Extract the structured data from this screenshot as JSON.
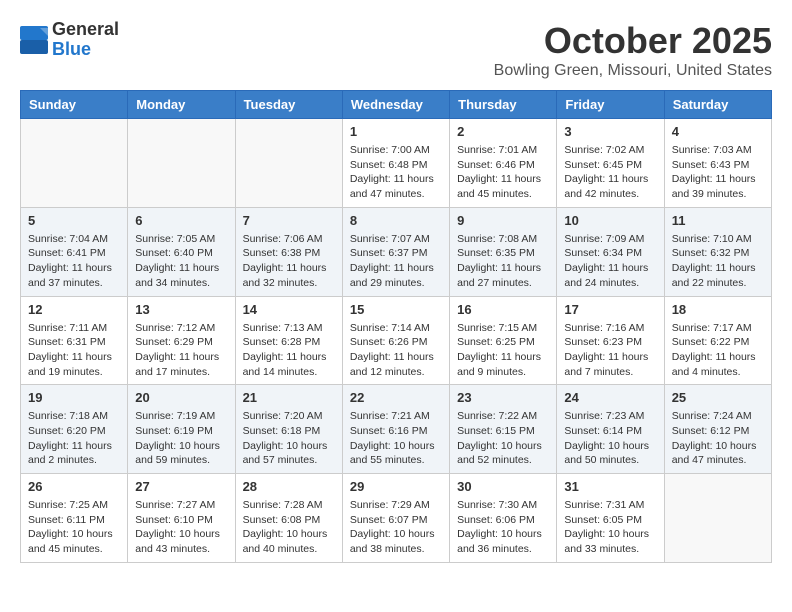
{
  "header": {
    "logo_general": "General",
    "logo_blue": "Blue",
    "month_title": "October 2025",
    "location": "Bowling Green, Missouri, United States"
  },
  "weekdays": [
    "Sunday",
    "Monday",
    "Tuesday",
    "Wednesday",
    "Thursday",
    "Friday",
    "Saturday"
  ],
  "weeks": [
    [
      {
        "day": "",
        "info": ""
      },
      {
        "day": "",
        "info": ""
      },
      {
        "day": "",
        "info": ""
      },
      {
        "day": "1",
        "info": "Sunrise: 7:00 AM\nSunset: 6:48 PM\nDaylight: 11 hours\nand 47 minutes."
      },
      {
        "day": "2",
        "info": "Sunrise: 7:01 AM\nSunset: 6:46 PM\nDaylight: 11 hours\nand 45 minutes."
      },
      {
        "day": "3",
        "info": "Sunrise: 7:02 AM\nSunset: 6:45 PM\nDaylight: 11 hours\nand 42 minutes."
      },
      {
        "day": "4",
        "info": "Sunrise: 7:03 AM\nSunset: 6:43 PM\nDaylight: 11 hours\nand 39 minutes."
      }
    ],
    [
      {
        "day": "5",
        "info": "Sunrise: 7:04 AM\nSunset: 6:41 PM\nDaylight: 11 hours\nand 37 minutes."
      },
      {
        "day": "6",
        "info": "Sunrise: 7:05 AM\nSunset: 6:40 PM\nDaylight: 11 hours\nand 34 minutes."
      },
      {
        "day": "7",
        "info": "Sunrise: 7:06 AM\nSunset: 6:38 PM\nDaylight: 11 hours\nand 32 minutes."
      },
      {
        "day": "8",
        "info": "Sunrise: 7:07 AM\nSunset: 6:37 PM\nDaylight: 11 hours\nand 29 minutes."
      },
      {
        "day": "9",
        "info": "Sunrise: 7:08 AM\nSunset: 6:35 PM\nDaylight: 11 hours\nand 27 minutes."
      },
      {
        "day": "10",
        "info": "Sunrise: 7:09 AM\nSunset: 6:34 PM\nDaylight: 11 hours\nand 24 minutes."
      },
      {
        "day": "11",
        "info": "Sunrise: 7:10 AM\nSunset: 6:32 PM\nDaylight: 11 hours\nand 22 minutes."
      }
    ],
    [
      {
        "day": "12",
        "info": "Sunrise: 7:11 AM\nSunset: 6:31 PM\nDaylight: 11 hours\nand 19 minutes."
      },
      {
        "day": "13",
        "info": "Sunrise: 7:12 AM\nSunset: 6:29 PM\nDaylight: 11 hours\nand 17 minutes."
      },
      {
        "day": "14",
        "info": "Sunrise: 7:13 AM\nSunset: 6:28 PM\nDaylight: 11 hours\nand 14 minutes."
      },
      {
        "day": "15",
        "info": "Sunrise: 7:14 AM\nSunset: 6:26 PM\nDaylight: 11 hours\nand 12 minutes."
      },
      {
        "day": "16",
        "info": "Sunrise: 7:15 AM\nSunset: 6:25 PM\nDaylight: 11 hours\nand 9 minutes."
      },
      {
        "day": "17",
        "info": "Sunrise: 7:16 AM\nSunset: 6:23 PM\nDaylight: 11 hours\nand 7 minutes."
      },
      {
        "day": "18",
        "info": "Sunrise: 7:17 AM\nSunset: 6:22 PM\nDaylight: 11 hours\nand 4 minutes."
      }
    ],
    [
      {
        "day": "19",
        "info": "Sunrise: 7:18 AM\nSunset: 6:20 PM\nDaylight: 11 hours\nand 2 minutes."
      },
      {
        "day": "20",
        "info": "Sunrise: 7:19 AM\nSunset: 6:19 PM\nDaylight: 10 hours\nand 59 minutes."
      },
      {
        "day": "21",
        "info": "Sunrise: 7:20 AM\nSunset: 6:18 PM\nDaylight: 10 hours\nand 57 minutes."
      },
      {
        "day": "22",
        "info": "Sunrise: 7:21 AM\nSunset: 6:16 PM\nDaylight: 10 hours\nand 55 minutes."
      },
      {
        "day": "23",
        "info": "Sunrise: 7:22 AM\nSunset: 6:15 PM\nDaylight: 10 hours\nand 52 minutes."
      },
      {
        "day": "24",
        "info": "Sunrise: 7:23 AM\nSunset: 6:14 PM\nDaylight: 10 hours\nand 50 minutes."
      },
      {
        "day": "25",
        "info": "Sunrise: 7:24 AM\nSunset: 6:12 PM\nDaylight: 10 hours\nand 47 minutes."
      }
    ],
    [
      {
        "day": "26",
        "info": "Sunrise: 7:25 AM\nSunset: 6:11 PM\nDaylight: 10 hours\nand 45 minutes."
      },
      {
        "day": "27",
        "info": "Sunrise: 7:27 AM\nSunset: 6:10 PM\nDaylight: 10 hours\nand 43 minutes."
      },
      {
        "day": "28",
        "info": "Sunrise: 7:28 AM\nSunset: 6:08 PM\nDaylight: 10 hours\nand 40 minutes."
      },
      {
        "day": "29",
        "info": "Sunrise: 7:29 AM\nSunset: 6:07 PM\nDaylight: 10 hours\nand 38 minutes."
      },
      {
        "day": "30",
        "info": "Sunrise: 7:30 AM\nSunset: 6:06 PM\nDaylight: 10 hours\nand 36 minutes."
      },
      {
        "day": "31",
        "info": "Sunrise: 7:31 AM\nSunset: 6:05 PM\nDaylight: 10 hours\nand 33 minutes."
      },
      {
        "day": "",
        "info": ""
      }
    ]
  ]
}
